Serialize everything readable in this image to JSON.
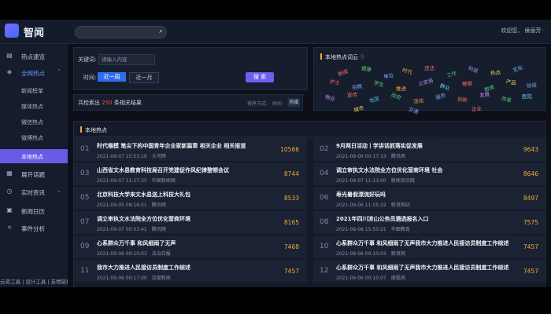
{
  "app": {
    "name": "智闻"
  },
  "header": {
    "user_text": "欢迎您， 侯丽芳 ·"
  },
  "sidebar": {
    "items": [
      {
        "label": "热点速览",
        "icon": "chart-icon"
      },
      {
        "label": "全网热点",
        "icon": "drop-icon",
        "expanded": true,
        "children": [
          "新闻榜单",
          "媒体热点",
          "微信热点",
          "微博热点",
          "本地热点"
        ],
        "selected": "本地热点"
      },
      {
        "label": "展开话题",
        "icon": "grid-icon"
      },
      {
        "label": "实时资讯",
        "icon": "clock-icon"
      },
      {
        "label": "新闻日历",
        "icon": "calendar-icon"
      },
      {
        "label": "事件分析",
        "icon": "bookmark-icon"
      }
    ],
    "footer": "云资工具 | 设计工具 | 友情链接"
  },
  "search_panel": {
    "keyword_label": "关键词:",
    "keyword_placeholder": "请输入内容",
    "time_label": "时间:",
    "time_options": [
      "近一周",
      "近一月"
    ],
    "time_selected": "近一周",
    "search_button": "搜 索"
  },
  "result_bar": {
    "prefix": "共检索出",
    "count": "250",
    "suffix": "条相关结果",
    "sort_label": "排序方式:",
    "sort_time": "时间",
    "sort_hot": "热度"
  },
  "word_cloud": {
    "title": "本地热点词云",
    "words": [
      {
        "t": "新闻",
        "c": "#ff6b6b"
      },
      {
        "t": "健康",
        "c": "#4ecb71"
      },
      {
        "t": "单位",
        "c": "#7aa2ff"
      },
      {
        "t": "时代",
        "c": "#f2a93b"
      },
      {
        "t": "违法",
        "c": "#ff6b6b"
      },
      {
        "t": "工作",
        "c": "#4ecb71"
      },
      {
        "t": "科技",
        "c": "#c08bff"
      },
      {
        "t": "热点",
        "c": "#ffd166"
      },
      {
        "t": "文化",
        "c": "#62d2ff"
      },
      {
        "t": "护士",
        "c": "#ff6b6b"
      },
      {
        "t": "招聘",
        "c": "#7aa2ff"
      },
      {
        "t": "学生",
        "c": "#4ecb71"
      },
      {
        "t": "推进",
        "c": "#f2a93b"
      },
      {
        "t": "公安局",
        "c": "#c08bff"
      },
      {
        "t": "群众",
        "c": "#62d2ff"
      },
      {
        "t": "警察",
        "c": "#ff6b6b"
      },
      {
        "t": "教育",
        "c": "#4ecb71"
      },
      {
        "t": "产品",
        "c": "#ffd166"
      },
      {
        "t": "防疫",
        "c": "#7aa2ff"
      },
      {
        "t": "物业",
        "c": "#c08bff"
      },
      {
        "t": "宣传",
        "c": "#ff6b6b"
      },
      {
        "t": "社区",
        "c": "#62d2ff"
      },
      {
        "t": "政府",
        "c": "#4ecb71"
      },
      {
        "t": "活动",
        "c": "#f2a93b"
      },
      {
        "t": "服务",
        "c": "#7aa2ff"
      },
      {
        "t": "创新",
        "c": "#ff6b6b"
      },
      {
        "t": "发展",
        "c": "#c08bff"
      },
      {
        "t": "改革",
        "c": "#4ecb71"
      },
      {
        "t": "医院",
        "c": "#62d2ff"
      },
      {
        "t": "城市",
        "c": "#ffd166"
      },
      {
        "t": "交通",
        "c": "#7aa2ff"
      },
      {
        "t": "企业",
        "c": "#ff6b6b"
      }
    ]
  },
  "hot_list": {
    "title": "本地热点",
    "items": [
      {
        "num": "01",
        "title": "时代楷模 笔尖下的中国青年企业家新篇章 相关企业 相关报道",
        "date": "2021-09-07 15:53:19",
        "source": "大河网",
        "score": "10566"
      },
      {
        "num": "02",
        "title": "9月两日活动丨学讲话抓落实促发展",
        "date": "2021-09-06 00:17:13",
        "source": "腾讯网",
        "score": "9643"
      },
      {
        "num": "03",
        "title": "山西省文水县教育科技局召开党建促作风纪律整顿会议",
        "date": "2021-09-07 11:17:35",
        "source": "中国新闻网",
        "score": "8744"
      },
      {
        "num": "04",
        "title": "调立审执文水法院全方位优化营商环境 社会",
        "date": "2021-09-07 11:13:00",
        "source": "新闻资讯网",
        "score": "8646"
      },
      {
        "num": "05",
        "title": "北京科技大学来文水县送上科技大礼包",
        "date": "2021-09-05 08:16:51",
        "source": "腾讯网",
        "score": "8533"
      },
      {
        "num": "06",
        "title": "寿光暑假漂流好玩吗",
        "date": "2021-09-06 11:55:32",
        "source": "新浪网站",
        "score": "8497"
      },
      {
        "num": "07",
        "title": "调立审执文水法院全方位优化营商环境",
        "date": "2021-09-07 00:03:41",
        "source": "腾讯网",
        "score": "8165"
      },
      {
        "num": "08",
        "title": "2021年四川凉山公务员遴选报名入口",
        "date": "2021-09-08 15:50:21",
        "source": "华图教育",
        "score": "7575"
      },
      {
        "num": "09",
        "title": "心系群众万千事 和风细雨了无声",
        "date": "2021-09-06 00:10:03",
        "source": "法治日报",
        "score": "7468"
      },
      {
        "num": "10",
        "title": "心系群众万千事 和风细雨了无声我市大力推进人民接访员制度工作综述",
        "date": "2021-09-06 00:10:03",
        "source": "新浪网",
        "score": "7457"
      },
      {
        "num": "11",
        "title": "我市大力推进人民接访员制度工作综述",
        "date": "2021-09-06 00:17:00",
        "source": "百度新闻",
        "score": "7457"
      },
      {
        "num": "12",
        "title": "心系群众万千事 和风细雨了无声我市大力推进人民接访员制度工作综述",
        "date": "2021-09-06 00:10:07",
        "source": "搜狐网",
        "score": "7457"
      }
    ]
  }
}
